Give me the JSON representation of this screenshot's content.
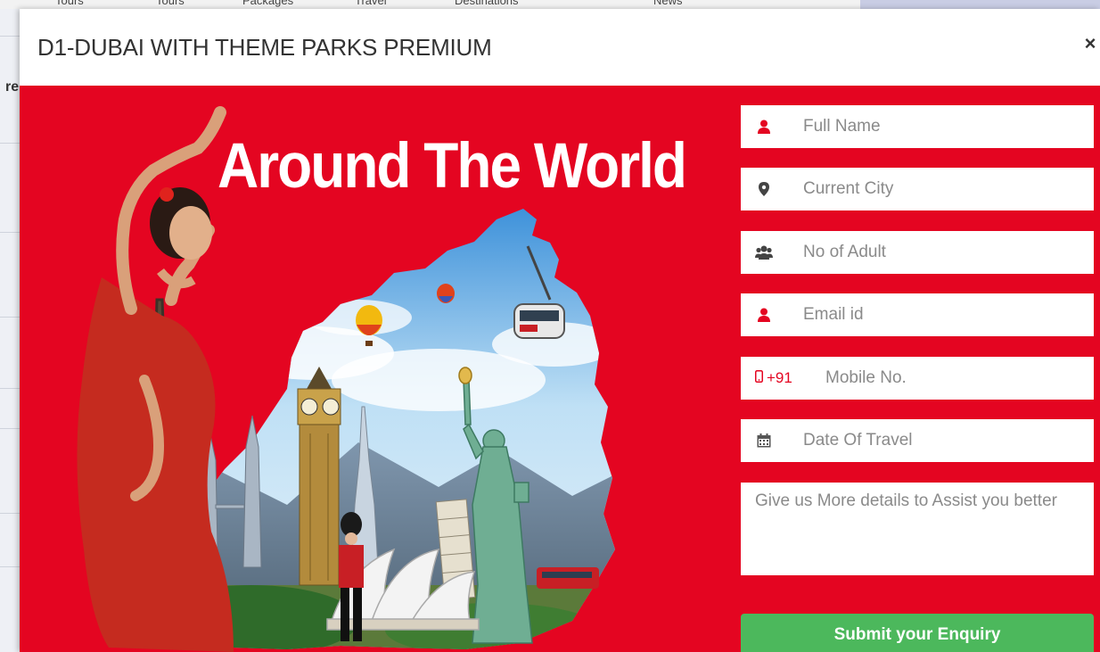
{
  "background_page": {
    "nav_items": [
      "Tours",
      "Tours",
      "Packages",
      "Travel",
      "Destinations",
      "News"
    ],
    "side_text": "re"
  },
  "modal": {
    "title": "D1-DUBAI WITH THEME PARKS PREMIUM",
    "close_label": "×"
  },
  "promo": {
    "headline": "Around The World"
  },
  "form": {
    "full_name_placeholder": "Full Name",
    "city_placeholder": "Current City",
    "adults_placeholder": "No of Adult",
    "email_placeholder": "Email id",
    "country_code": "+91",
    "mobile_placeholder": "Mobile No.",
    "date_placeholder": "Date Of Travel",
    "details_placeholder": "Give us More details to Assist you better",
    "submit_label": "Submit your Enquiry"
  },
  "colors": {
    "brand_red": "#e40521",
    "submit_green": "#4cb85c"
  }
}
